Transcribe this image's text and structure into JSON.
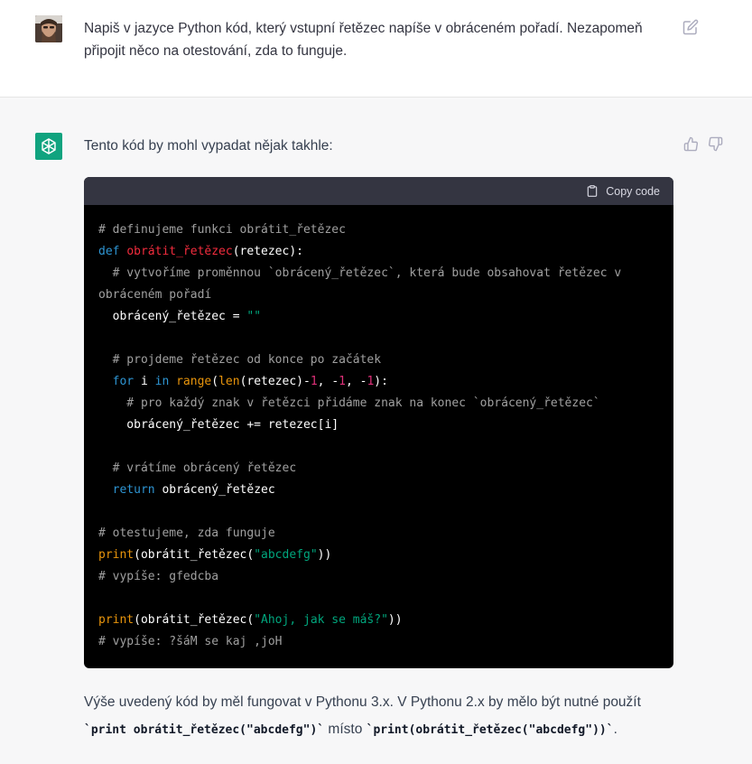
{
  "user_message": {
    "text": "Napiš v jazyce Python kód, který vstupní řetězec napíše v obráceném pořadí. Nezapomeň připojit něco na otestování, zda to funguje.",
    "avatar": "user-photo",
    "edit_icon": "edit-icon"
  },
  "assistant_message": {
    "avatar": "openai-logo-icon",
    "avatar_color": "#10a37f",
    "intro": "Tento kód by mohl vypadat nějak takhle:",
    "feedback": {
      "up_icon": "thumbs-up-icon",
      "down_icon": "thumbs-down-icon"
    },
    "code_block": {
      "copy_label": "Copy code",
      "copy_icon": "clipboard-icon",
      "lines": [
        [
          {
            "t": "# definujeme funkci obrátit_řetězec",
            "c": "cm"
          }
        ],
        [
          {
            "t": "def ",
            "c": "kw"
          },
          {
            "t": "obrátit_řetězec",
            "c": "fn"
          },
          {
            "t": "(retezec):",
            "c": ""
          }
        ],
        [
          {
            "t": "  # vytvoříme proměnnou `obrácený_řetězec`, která bude obsahovat řetězec v",
            "c": "cm"
          }
        ],
        [
          {
            "t": "obráceném pořadí",
            "c": "cm"
          }
        ],
        [
          {
            "t": "  obrácený_řetězec = ",
            "c": ""
          },
          {
            "t": "\"\"",
            "c": "st"
          }
        ],
        [
          {
            "t": "",
            "c": ""
          }
        ],
        [
          {
            "t": "  # projdeme řetězec od konce po začátek",
            "c": "cm"
          }
        ],
        [
          {
            "t": "  ",
            "c": ""
          },
          {
            "t": "for",
            "c": "kw"
          },
          {
            "t": " i ",
            "c": ""
          },
          {
            "t": "in",
            "c": "kw"
          },
          {
            "t": " ",
            "c": ""
          },
          {
            "t": "range",
            "c": "bi"
          },
          {
            "t": "(",
            "c": ""
          },
          {
            "t": "len",
            "c": "bi"
          },
          {
            "t": "(retezec)-",
            "c": ""
          },
          {
            "t": "1",
            "c": "nu"
          },
          {
            "t": ", -",
            "c": ""
          },
          {
            "t": "1",
            "c": "nu"
          },
          {
            "t": ", -",
            "c": ""
          },
          {
            "t": "1",
            "c": "nu"
          },
          {
            "t": "):",
            "c": ""
          }
        ],
        [
          {
            "t": "    # pro každý znak v řetězci přidáme znak na konec `obrácený_řetězec`",
            "c": "cm"
          }
        ],
        [
          {
            "t": "    obrácený_řetězec += retezec[i]",
            "c": ""
          }
        ],
        [
          {
            "t": "",
            "c": ""
          }
        ],
        [
          {
            "t": "  # vrátíme obrácený řetězec",
            "c": "cm"
          }
        ],
        [
          {
            "t": "  ",
            "c": ""
          },
          {
            "t": "return",
            "c": "kw"
          },
          {
            "t": " obrácený_řetězec",
            "c": ""
          }
        ],
        [
          {
            "t": "",
            "c": ""
          }
        ],
        [
          {
            "t": "# otestujeme, zda funguje",
            "c": "cm"
          }
        ],
        [
          {
            "t": "print",
            "c": "bi"
          },
          {
            "t": "(obrátit_řetězec(",
            "c": ""
          },
          {
            "t": "\"abcdefg\"",
            "c": "st"
          },
          {
            "t": "))",
            "c": ""
          }
        ],
        [
          {
            "t": "# vypíše: gfedcba",
            "c": "cm"
          }
        ],
        [
          {
            "t": "",
            "c": ""
          }
        ],
        [
          {
            "t": "print",
            "c": "bi"
          },
          {
            "t": "(obrátit_řetězec(",
            "c": ""
          },
          {
            "t": "\"Ahoj, jak se máš?\"",
            "c": "st"
          },
          {
            "t": "))",
            "c": ""
          }
        ],
        [
          {
            "t": "# vypíše: ?šáM se kaj ,joH",
            "c": "cm"
          }
        ]
      ]
    },
    "outro": {
      "text_1": "Výše uvedený kód by měl fungovat v Pythonu 3.x. V Pythonu 2.x by mělo být nutné použít ",
      "code_1": "`print obrátit_řetězec(\"abcdefg\")`",
      "text_2": " místo ",
      "code_2": "`print(obrátit_řetězec(\"abcdefg\"))`",
      "text_3": "."
    }
  }
}
